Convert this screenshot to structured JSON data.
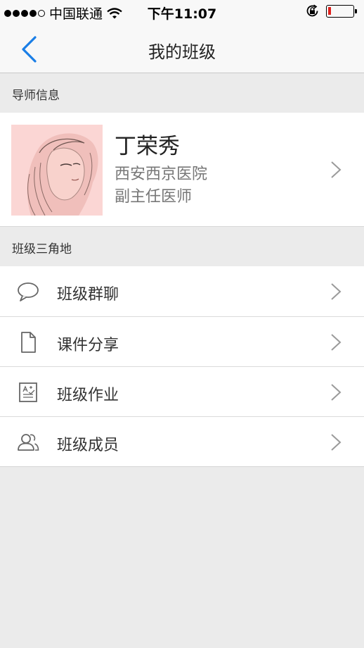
{
  "status_bar": {
    "carrier": "中国联通",
    "time": "下午11:07",
    "signal_filled": 4,
    "signal_total": 5,
    "battery_level": 0.12,
    "battery_color": "#e0201c"
  },
  "nav": {
    "title": "我的班级",
    "back_icon": "chevron-left-icon",
    "accent_color": "#1a7ee6"
  },
  "tutor_section": {
    "header": "导师信息",
    "name": "丁荣秀",
    "hospital": "西安西京医院",
    "position": "副主任医师"
  },
  "class_section": {
    "header": "班级三角地",
    "items": [
      {
        "label": "班级群聊",
        "icon": "chat-bubble-icon"
      },
      {
        "label": "课件分享",
        "icon": "document-icon"
      },
      {
        "label": "班级作业",
        "icon": "homework-icon"
      },
      {
        "label": "班级成员",
        "icon": "members-icon"
      }
    ]
  }
}
